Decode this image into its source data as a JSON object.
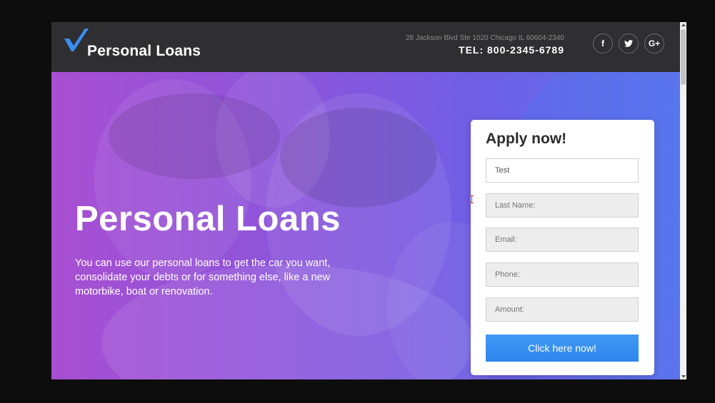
{
  "header": {
    "logo_text": "Personal Loans",
    "address": "28 Jackson Blvd Ste 1020 Chicago IL 60604-2340",
    "tel": "TEL: 800-2345-6789",
    "social": [
      {
        "label": "f",
        "icon": "facebook-icon"
      },
      {
        "label": "♥",
        "icon": "twitter-icon"
      },
      {
        "label": "G+",
        "icon": "google-plus-icon"
      }
    ]
  },
  "hero": {
    "title": "Personal Loans",
    "text": "You can use our personal loans to get the car you want, consolidate your debts or for something else, like a new motorbike, boat or renovation."
  },
  "form": {
    "title": "Apply now!",
    "first_name_value": "Test",
    "last_name_placeholder": "Last Name:",
    "email_placeholder": "Email:",
    "phone_placeholder": "Phone:",
    "amount_placeholder": "Amount:",
    "submit_label": "Click here now!"
  },
  "colors": {
    "header_bg": "#2f2f31",
    "accent_blue": "#2f86ee",
    "logo_check": "#3a8ff5",
    "hero_gradient_start": "#a84fd2",
    "hero_gradient_end": "#5b74ee"
  }
}
